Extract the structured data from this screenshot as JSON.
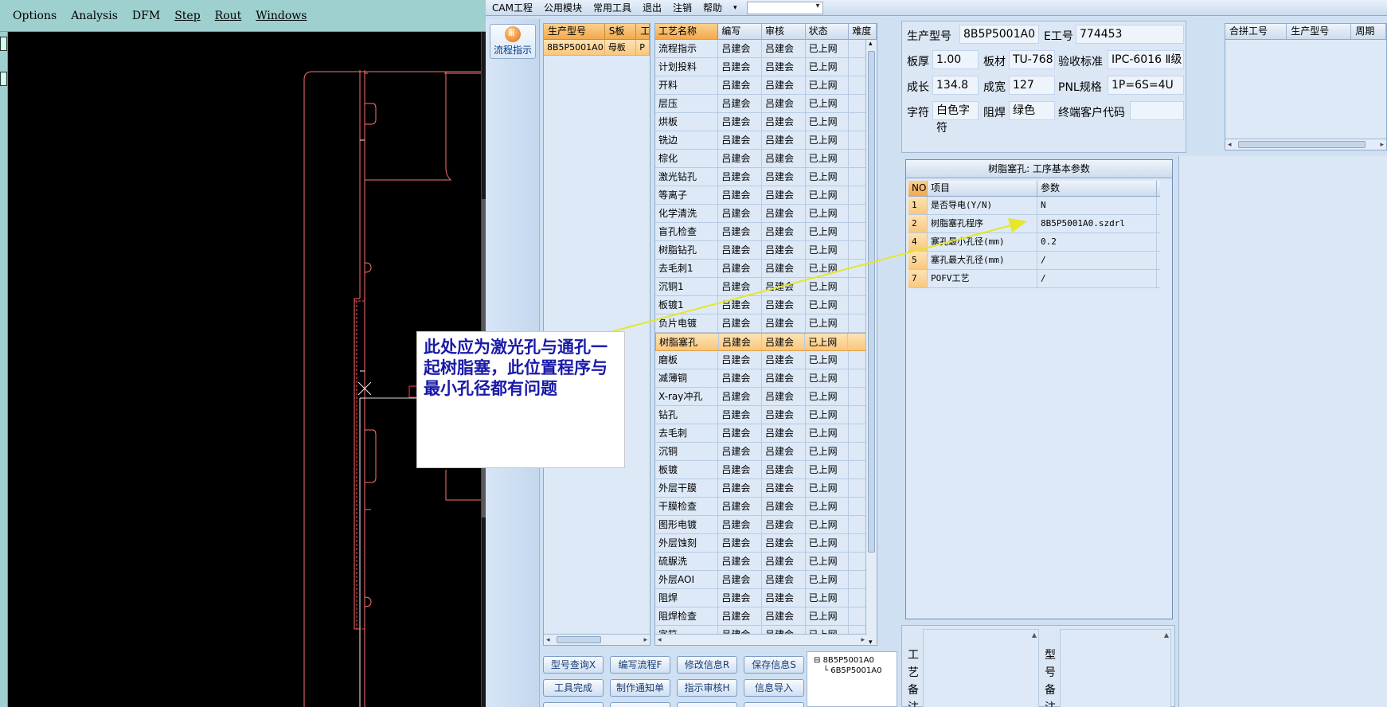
{
  "cad": {
    "menu": [
      "Options",
      "Analysis",
      "DFM",
      "Step",
      "Rout",
      "Windows"
    ]
  },
  "annotation": {
    "text": "此处应为激光孔与通孔一起树脂塞，此位置程序与最小孔径都有问题"
  },
  "app": {
    "menu": [
      "CAM工程",
      "公用模块",
      "常用工具",
      "退出",
      "注销",
      "帮助"
    ],
    "flow_button": "流程指示",
    "model_grid": {
      "headers": [
        "生产型号",
        "S板",
        "工"
      ],
      "row": [
        "8B5P5001A0",
        "母板",
        "P"
      ]
    },
    "process_grid": {
      "headers": [
        "工艺名称",
        "编写",
        "审核",
        "状态",
        "难度"
      ],
      "writer": "吕建会",
      "reviewer": "吕建会",
      "status": "已上网",
      "steps": [
        "流程指示",
        "计划投料",
        "开料",
        "层压",
        "烘板",
        "铣边",
        "棕化",
        "激光钻孔",
        "等离子",
        "化学清洗",
        "盲孔检查",
        "树脂钻孔",
        "去毛刺1",
        "沉铜1",
        "板镀1",
        "负片电镀",
        "树脂塞孔",
        "磨板",
        "减薄铜",
        "X-ray冲孔",
        "钻孔",
        "去毛刺",
        "沉铜",
        "板镀",
        "外层干膜",
        "干膜检查",
        "图形电镀",
        "外层蚀刻",
        "硫脲洗",
        "外层AOI",
        "阻焊",
        "阻焊检查",
        "字符"
      ],
      "selected_step": "树脂塞孔"
    },
    "buttons": [
      [
        "型号查询X",
        "编写流程F",
        "修改信息R",
        "保存信息S"
      ],
      [
        "工具完成",
        "制作通知单",
        "指示审核H",
        "信息导入"
      ]
    ],
    "tree": [
      "8B5P5001A0",
      "6B5P5001A0"
    ],
    "info": {
      "model_label": "生产型号",
      "model_value": "8B5P5001A0",
      "e_label": "E工号",
      "e_value": "774453",
      "thickness_label": "板厚",
      "thickness_value": "1.00",
      "material_label": "板材",
      "material_value": "TU-768",
      "standard_label": "验收标准",
      "standard_value": "IPC-6016 Ⅱ级",
      "length_label": "成长",
      "length_value": "134.8",
      "width_label": "成宽",
      "width_value": "127",
      "pnl_label": "PNL规格",
      "pnl_value": "1P=6S=4U",
      "char_label": "字符",
      "char_value": "白色字符",
      "mask_label": "阻焊",
      "mask_value": "绿色",
      "customer_label": "终端客户代码",
      "customer_value": ""
    },
    "merge_grid": {
      "headers": [
        "合拼工号",
        "生产型号",
        "周期"
      ]
    },
    "param_panel": {
      "title": "树脂塞孔: 工序基本参数",
      "headers": [
        "NO",
        "项目",
        "参数"
      ],
      "rows": [
        [
          "1",
          "是否导电(Y/N)",
          "N"
        ],
        [
          "2",
          "树脂塞孔程序",
          "8B5P5001A0.szdrl"
        ],
        [
          "4",
          "塞孔最小孔径(mm)",
          "0.2"
        ],
        [
          "5",
          "塞孔最大孔径(mm)",
          "/"
        ],
        [
          "7",
          "POFV工艺",
          "/"
        ]
      ]
    },
    "remarks": {
      "process_label": "工艺备注",
      "model_label": "型号备注"
    }
  }
}
